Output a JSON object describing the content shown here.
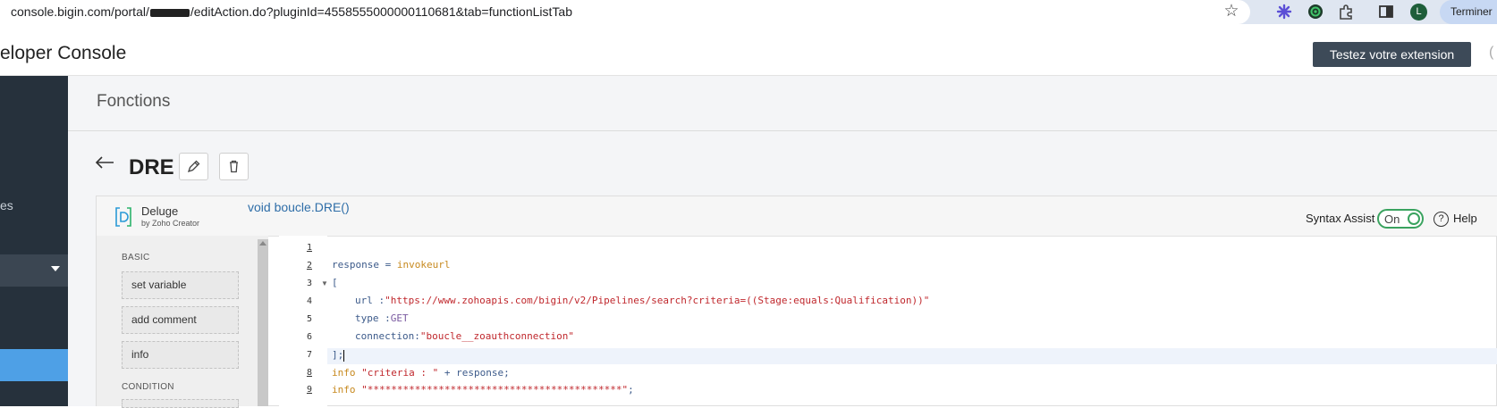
{
  "browser": {
    "url_prefix": "console.bigin.com/portal/",
    "url_suffix": "/editAction.do?pluginId=4558555000000110681&tab=functionListTab",
    "avatar_letter": "L",
    "terminer_label": "Terminer"
  },
  "header": {
    "title": "eloper Console",
    "test_button": "Testez votre extension",
    "edge_paren": "("
  },
  "sidebar": {
    "label_fragment": "es"
  },
  "page": {
    "section_title": "Fonctions",
    "function_name": "DRE"
  },
  "editor": {
    "brand_name": "Deluge",
    "brand_sub": "by Zoho Creator",
    "signature": "void  boucle.DRE()",
    "syntax_assist_label": "Syntax Assist",
    "toggle_label": "On",
    "help_label": "Help",
    "help_icon_glyph": "?"
  },
  "palette": {
    "basic_title": "BASIC",
    "items": [
      "set variable",
      "add comment",
      "info"
    ],
    "condition_title": "CONDITION"
  },
  "code": {
    "line_numbers": [
      "1",
      "2",
      "3",
      "4",
      "5",
      "6",
      "7",
      "8",
      "9"
    ],
    "line2_var": "response = ",
    "line2_kw": "invokeurl",
    "line3": "[",
    "line4_key": "url :",
    "line4_val": "\"https://www.zohoapis.com/bigin/v2/Pipelines/search?criteria=((Stage:equals:Qualification))\"",
    "line5_key": "type :",
    "line5_val": "GET",
    "line6_key": "connection:",
    "line6_val": "\"boucle__zoauthconnection\"",
    "line7": "];",
    "line8_kw": "info",
    "line8_str": "\"criteria : \"",
    "line8_rest": " + response;",
    "line9_kw": "info",
    "line9_str": "\"*******************************************\"",
    "line9_rest": ";"
  },
  "colors": {
    "accent_active": "#4ea0e6",
    "sidebar_bg": "#26313c",
    "toggle_on": "#3aa35f",
    "button_dark": "#3d4a58"
  }
}
